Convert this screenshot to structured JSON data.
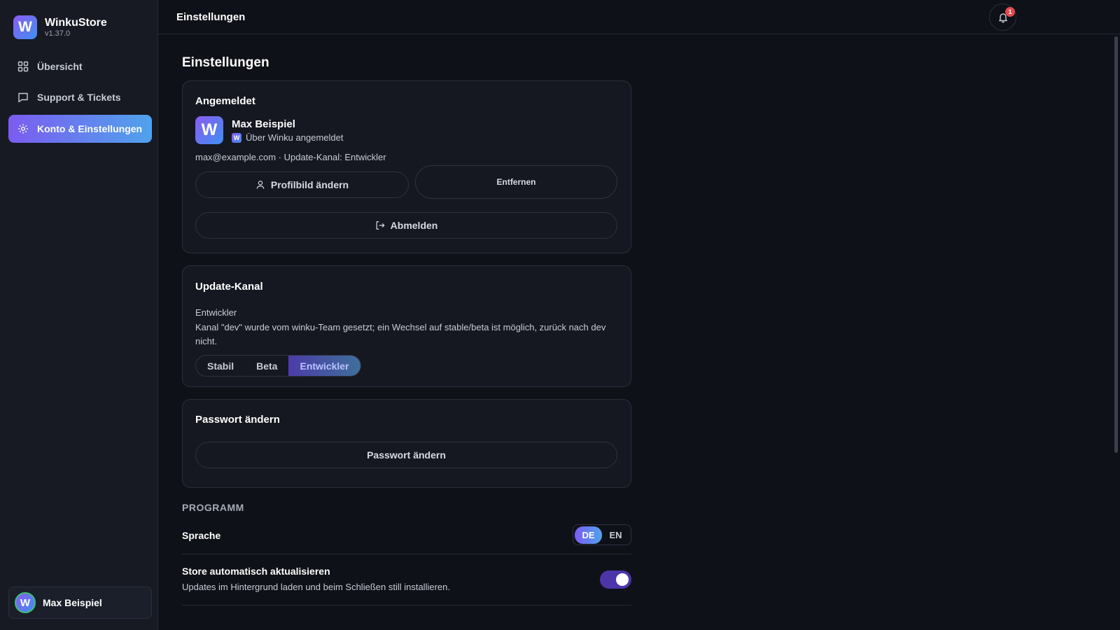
{
  "app": {
    "name": "WinkuStore",
    "version": "v1.37.0"
  },
  "sidebar": {
    "items": [
      {
        "label": "Übersicht",
        "icon": "grid-icon"
      },
      {
        "label": "Support & Tickets",
        "icon": "chat-icon"
      },
      {
        "label": "Konto & Einstellungen",
        "icon": "gear-icon",
        "active": true
      }
    ],
    "user": {
      "name": "Max Beispiel",
      "avatar_letter": "W"
    }
  },
  "header": {
    "title": "Einstellungen",
    "notifications": "1"
  },
  "main": {
    "title": "Einstellungen",
    "account": {
      "title": "Angemeldet",
      "avatar_letter": "W",
      "name": "Max Beispiel",
      "login_method": "Über Winku angemeldet",
      "meta": "max@example.com · Update-Kanal: Entwickler",
      "change_picture_label": "Profilbild ändern",
      "remove_label": "Entfernen",
      "logout_label": "Abmelden"
    },
    "channel": {
      "title": "Update-Kanal",
      "current": "Entwickler",
      "description": "Kanal \"dev\" wurde vom winku-Team gesetzt; ein Wechsel auf stable/beta ist möglich, zurück nach dev nicht.",
      "options": [
        "Stabil",
        "Beta",
        "Entwickler"
      ],
      "selected": "Entwickler"
    },
    "password": {
      "title": "Passwort ändern",
      "button_label": "Passwort ändern"
    },
    "program": {
      "section_label": "PROGRAMM",
      "language_label": "Sprache",
      "languages": [
        "DE",
        "EN"
      ],
      "selected_language": "DE",
      "auto_update_label": "Store automatisch aktualisieren",
      "auto_update_desc": "Updates im Hintergrund laden und beim Schließen still installieren.",
      "auto_update_on": true
    }
  },
  "colors": {
    "accent_start": "#7b5cf0",
    "accent_end": "#4fa3ec",
    "badge": "#e5484d",
    "background": "#0f1118"
  }
}
